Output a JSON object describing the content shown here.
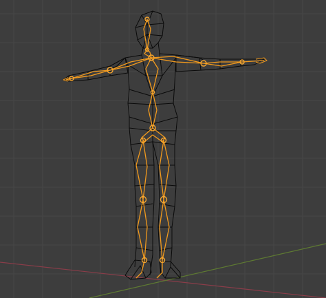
{
  "viewport": {
    "background_color": "#3d3d3d",
    "grid_color": "#474747",
    "x_axis_color": "#8a3d49",
    "y_axis_color": "#5e7a32"
  },
  "mesh": {
    "wire_color": "#0a0a0a"
  },
  "armature": {
    "bone_outline_color": "#f29a1d",
    "bone_fill_color": "#c06a1a",
    "joint_color": "#f5a631"
  }
}
